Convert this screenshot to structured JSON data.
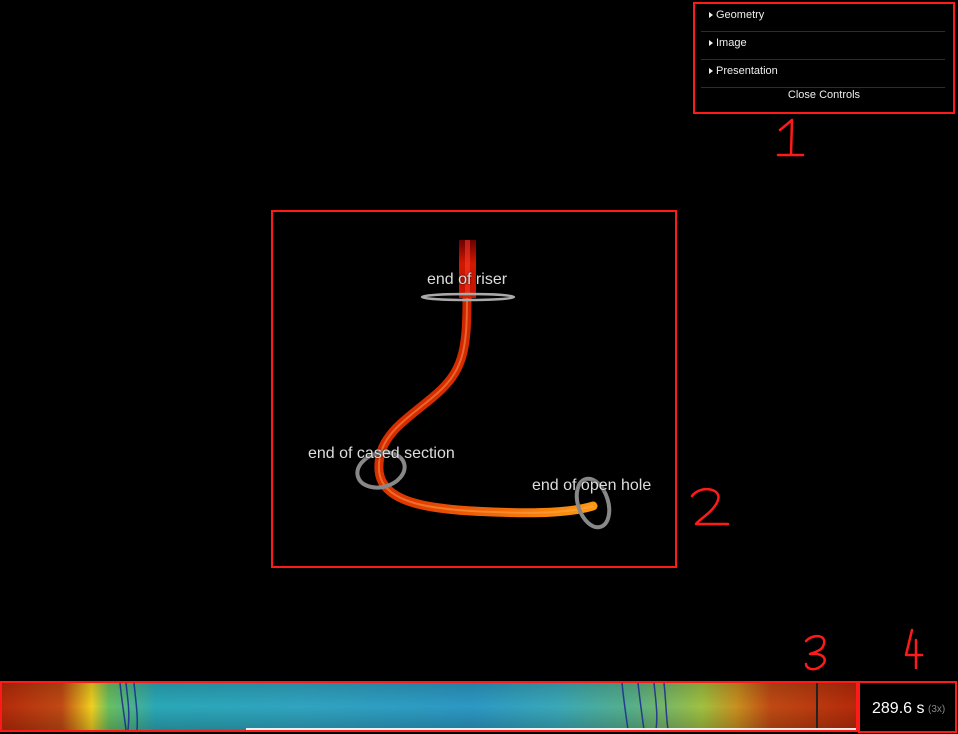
{
  "controls": {
    "folders": [
      "Geometry",
      "Image",
      "Presentation"
    ],
    "close_label": "Close Controls"
  },
  "scene": {
    "labels": {
      "riser": "end of riser",
      "cased": "end of cased section",
      "open_hole": "end of open hole"
    }
  },
  "timeline": {
    "time": "289.6 s",
    "speed": "(3x)"
  },
  "annotations": [
    "1",
    "2",
    "3",
    "4"
  ],
  "colors": {
    "highlight_box": "#ff1a1a",
    "pipe_top": "#cc1a00",
    "pipe_bottom": "#ff8800"
  }
}
